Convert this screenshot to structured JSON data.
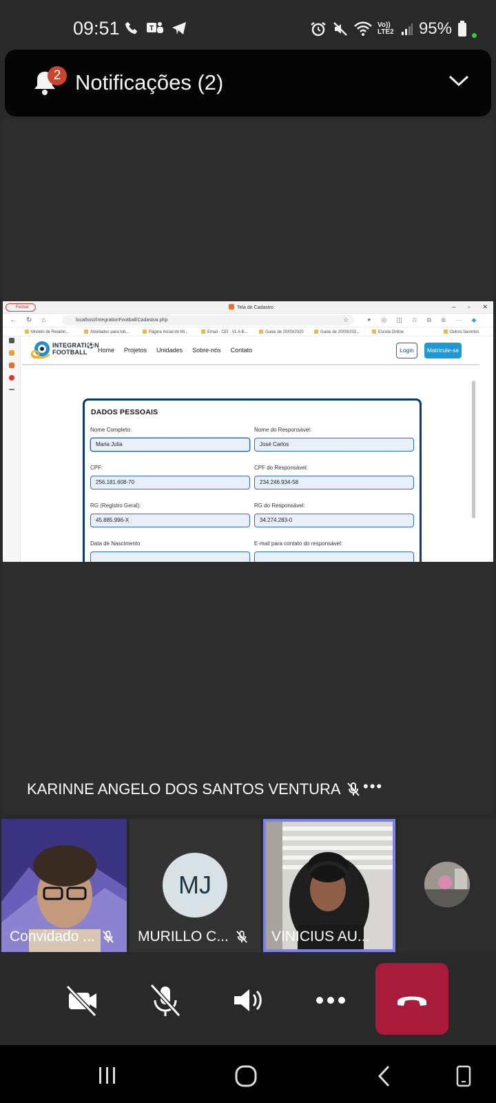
{
  "status_bar": {
    "time": "09:51",
    "network": "Vo)) LTE2",
    "battery": "95%",
    "icons": [
      "phone-icon",
      "teams-icon",
      "telegram-icon",
      "alarm-icon",
      "mute-icon",
      "wifi-icon",
      "signal-icon",
      "battery-icon"
    ]
  },
  "notifications": {
    "badge": "2",
    "title": "Notificações (2)"
  },
  "shared_screen": {
    "browser": {
      "profile": "Fechar",
      "tab_title": "Tela de Cadastro",
      "window_controls": [
        "–",
        "▫",
        "✕"
      ],
      "url": "localhost/IntegrationFootball/Cadastrar.php",
      "bookmarks": [
        "Modelo de Relatóri...",
        "Atividades para tub...",
        "Página Inicial do Mi...",
        "Email · CEI · VL A B...",
        "Guias de 20/09/2020",
        "Guias de 20/09/202...",
        "Escola Online",
        "Outros favoritos"
      ]
    },
    "site": {
      "logo_line1": "INTEGRATI⚽N",
      "logo_line2": "FOOTBALL",
      "menu": [
        "Home",
        "Projetos",
        "Unidades",
        "Sobre-nós",
        "Contato"
      ],
      "login": "Login",
      "signup": "Matricule-se",
      "form": {
        "title": "DADOS PESSOAIS",
        "fields": [
          {
            "label": "Nome Completo:",
            "value": "Maria Julia"
          },
          {
            "label": "Nome do Responsável:",
            "value": "José Carlos"
          },
          {
            "label": "CPF:",
            "value": "256.181.608-70"
          },
          {
            "label": "CPF do Responsável:",
            "value": "234.246.934-58"
          },
          {
            "label": "RG (Registro Geral):",
            "value": "45.885.996-X"
          },
          {
            "label": "RG do Responsável:",
            "value": "34.274.283-0"
          },
          {
            "label": "Data de Nascimento",
            "value": ""
          },
          {
            "label": "E-mail para contato do responsável:",
            "value": ""
          }
        ]
      }
    }
  },
  "meeting": {
    "active_speaker": "KARINNE ANGELO DOS SANTOS VENTURA",
    "more": "•••",
    "participants": [
      {
        "name": "Convidado ...",
        "muted": true
      },
      {
        "name": "MURILLO C...",
        "initials": "MJ",
        "muted": true
      },
      {
        "name": "VINICIUS AU...",
        "muted": false,
        "speaking": true
      },
      {
        "name": "",
        "muted": false
      }
    ],
    "controls": [
      "camera-off",
      "mic-off",
      "speaker",
      "more",
      "hang-up"
    ],
    "accent_color": "#7b83eb",
    "hangup_color": "#a81b3a"
  },
  "nav_bar": [
    "recents",
    "home",
    "back",
    "rotate"
  ]
}
